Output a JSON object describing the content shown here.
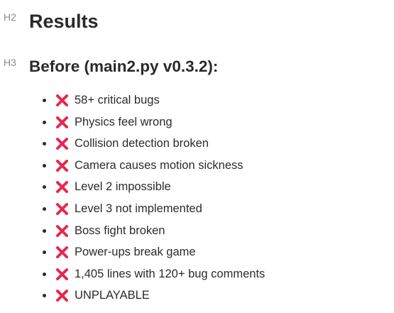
{
  "headings": {
    "h2_tag": "H2",
    "h2_title": "Results",
    "h3_tag": "H3",
    "h3_title": "Before (main2.py v0.3.2):"
  },
  "icon": {
    "name": "cross-mark-icon",
    "color": "#e5284f"
  },
  "items": [
    "58+ critical bugs",
    "Physics feel wrong",
    "Collision detection broken",
    "Camera causes motion sickness",
    "Level 2 impossible",
    "Level 3 not implemented",
    "Boss fight broken",
    "Power-ups break game",
    "1,405 lines with 120+ bug comments",
    "UNPLAYABLE"
  ]
}
